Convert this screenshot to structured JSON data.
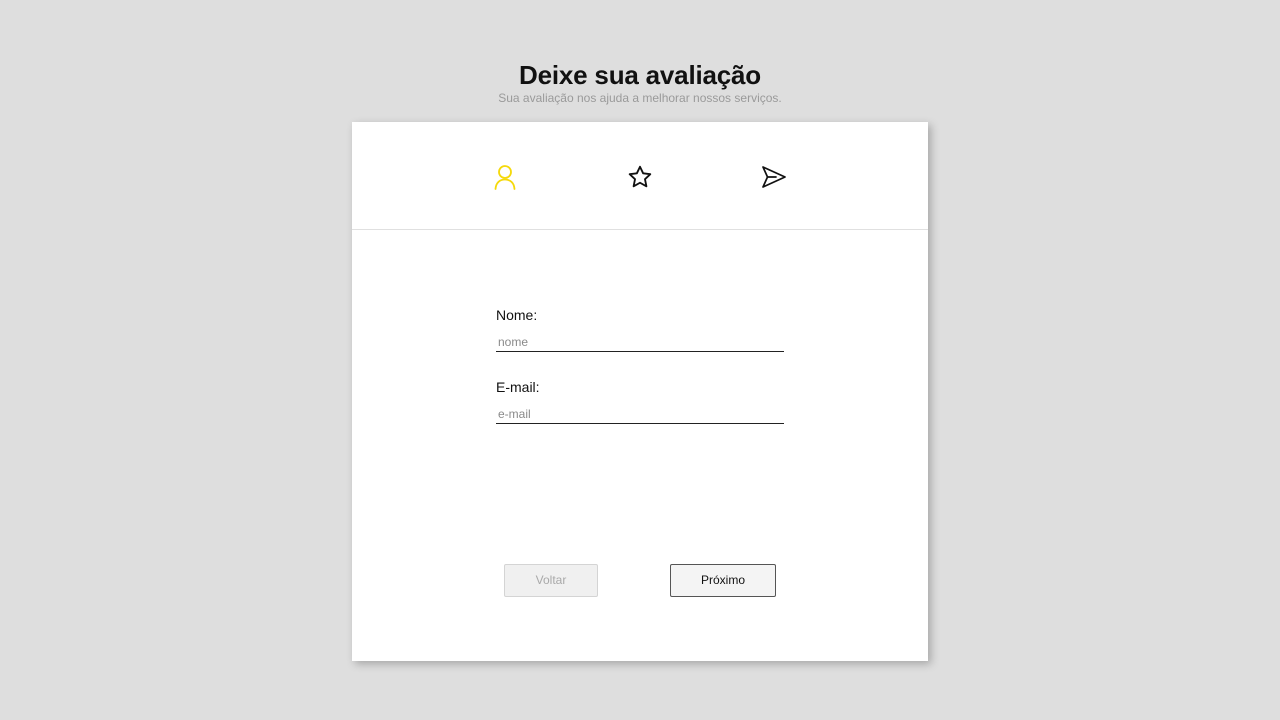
{
  "header": {
    "title": "Deixe sua avaliação",
    "subtitle": "Sua avaliação nos ajuda a melhorar nossos serviços."
  },
  "steps": [
    {
      "icon": "user-icon",
      "active": true
    },
    {
      "icon": "star-icon",
      "active": false
    },
    {
      "icon": "send-icon",
      "active": false
    }
  ],
  "form": {
    "name_label": "Nome:",
    "name_placeholder": "nome",
    "name_value": "",
    "email_label": "E-mail:",
    "email_placeholder": "e-mail",
    "email_value": ""
  },
  "buttons": {
    "back_label": "Voltar",
    "next_label": "Próximo"
  },
  "colors": {
    "active_step": "#f5d90a",
    "inactive_step": "#111111",
    "background": "#dedede"
  }
}
